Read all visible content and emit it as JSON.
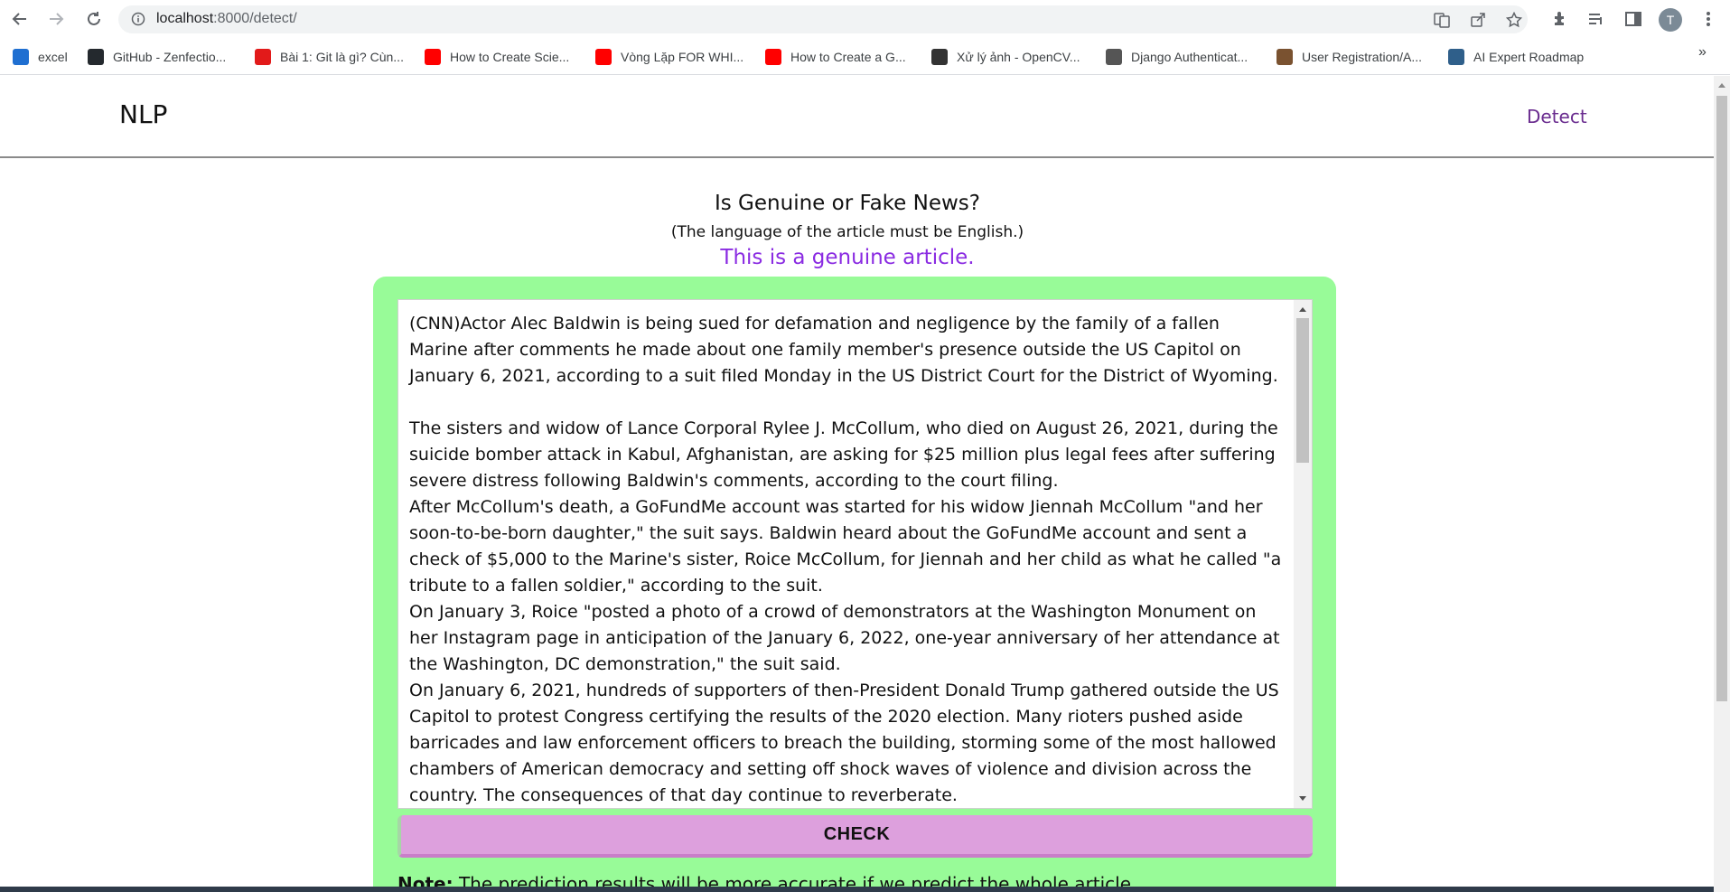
{
  "browser": {
    "url_host": "localhost",
    "url_path": ":8000/detect/",
    "avatar_letter": "T",
    "bookmarks": [
      {
        "label": "excel",
        "icon": "trello-icon",
        "color": "#1f6fd1"
      },
      {
        "label": "GitHub - Zenfectio...",
        "icon": "github-icon",
        "color": "#24292e"
      },
      {
        "label": "Bài 1: Git là gì? Cùn...",
        "icon": "adobe-icon",
        "color": "#e21a1a"
      },
      {
        "label": "How to Create Scie...",
        "icon": "youtube-icon",
        "color": "#ff0000"
      },
      {
        "label": "Vòng Lặp FOR WHI...",
        "icon": "youtube-icon",
        "color": "#ff0000"
      },
      {
        "label": "How to Create a G...",
        "icon": "youtube-icon",
        "color": "#ff0000"
      },
      {
        "label": "Xử lý ảnh - OpenCV...",
        "icon": "opencv-icon",
        "color": "#333333"
      },
      {
        "label": "Django Authenticat...",
        "icon": "globe-icon",
        "color": "#555555"
      },
      {
        "label": "User Registration/A...",
        "icon": "profile-icon",
        "color": "#7a5230"
      },
      {
        "label": "AI Expert Roadmap",
        "icon": "amai-icon",
        "color": "#2f5f8a"
      }
    ],
    "more": "»"
  },
  "navbar": {
    "brand": "NLP",
    "link": "Detect"
  },
  "main": {
    "heading": "Is Genuine or Fake News?",
    "subheading": "(The language of the article must be English.)",
    "result": "This is a genuine article.",
    "article_text": "(CNN)Actor Alec Baldwin is being sued for defamation and negligence by the family of a fallen Marine after comments he made about one family member's presence outside the US Capitol on January 6, 2021, according to a suit filed Monday in the US District Court for the District of Wyoming.\n\nThe sisters and widow of Lance Corporal Rylee J. McCollum, who died on August 26, 2021, during the suicide bomber attack in Kabul, Afghanistan, are asking for $25 million plus legal fees after suffering severe distress following Baldwin's comments, according to the court filing.\nAfter McCollum's death, a GoFundMe account was started for his widow Jiennah McCollum \"and her soon-to-be-born daughter,\" the suit says. Baldwin heard about the GoFundMe account and sent a check of $5,000 to the Marine's sister, Roice McCollum, for Jiennah and her child as what he called \"a tribute to a fallen soldier,\" according to the suit.\nOn January 3, Roice \"posted a photo of a crowd of demonstrators at the Washington Monument on her Instagram page in anticipation of the January 6, 2022, one-year anniversary of her attendance at the Washington, DC demonstration,\" the suit said.\nOn January 6, 2021, hundreds of supporters of then-President Donald Trump gathered outside the US Capitol to protest Congress certifying the results of the 2020 election. Many rioters pushed aside barricades and law enforcement officers to breach the building, storming some of the most hallowed chambers of American democracy and setting off shock waves of violence and division across the country. The consequences of that day continue to reverberate.",
    "check_label": "CHECK",
    "note_label": "Note:",
    "note_text": " The prediction results will be more accurate if we predict the whole article."
  },
  "colors": {
    "panel": "#98fb98",
    "button": "#dda0dd",
    "result": "#8a2be2",
    "nav_link": "#6a2c8f"
  }
}
